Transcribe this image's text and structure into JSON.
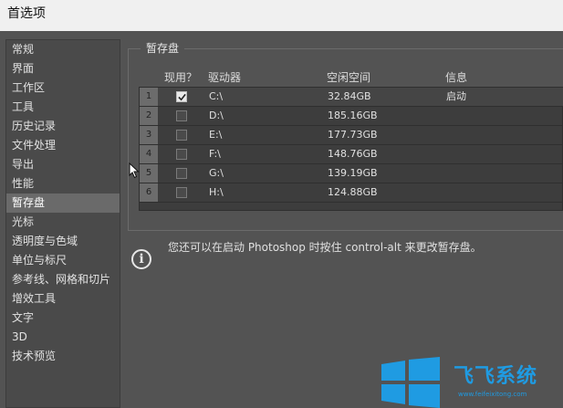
{
  "window": {
    "title": "首选项"
  },
  "sidebar": {
    "items": [
      "常规",
      "界面",
      "工作区",
      "工具",
      "历史记录",
      "文件处理",
      "导出",
      "性能",
      "暂存盘",
      "光标",
      "透明度与色域",
      "单位与标尺",
      "参考线、网格和切片",
      "增效工具",
      "文字",
      "3D",
      "技术预览"
    ],
    "active_index": 8
  },
  "scratch": {
    "group_title": "暂存盘",
    "columns": {
      "active": "现用？",
      "drive": "驱动器",
      "free": "空闲空间",
      "info": "信息"
    },
    "rows": [
      {
        "num": "1",
        "checked": true,
        "drive": "C:\\",
        "free": "32.84GB",
        "info": "启动"
      },
      {
        "num": "2",
        "checked": false,
        "drive": "D:\\",
        "free": "185.16GB",
        "info": ""
      },
      {
        "num": "3",
        "checked": false,
        "drive": "E:\\",
        "free": "177.73GB",
        "info": ""
      },
      {
        "num": "4",
        "checked": false,
        "drive": "F:\\",
        "free": "148.76GB",
        "info": ""
      },
      {
        "num": "5",
        "checked": false,
        "drive": "G:\\",
        "free": "139.19GB",
        "info": ""
      },
      {
        "num": "6",
        "checked": false,
        "drive": "H:\\",
        "free": "124.88GB",
        "info": ""
      }
    ]
  },
  "info": {
    "icon": "info-icon",
    "text": "您还可以在启动 Photoshop 时按住 control-alt 来更改暂存盘。"
  },
  "watermark": {
    "brand": "飞飞系统",
    "url": "www.feifeixitong.com",
    "color": "#1f9be2"
  }
}
